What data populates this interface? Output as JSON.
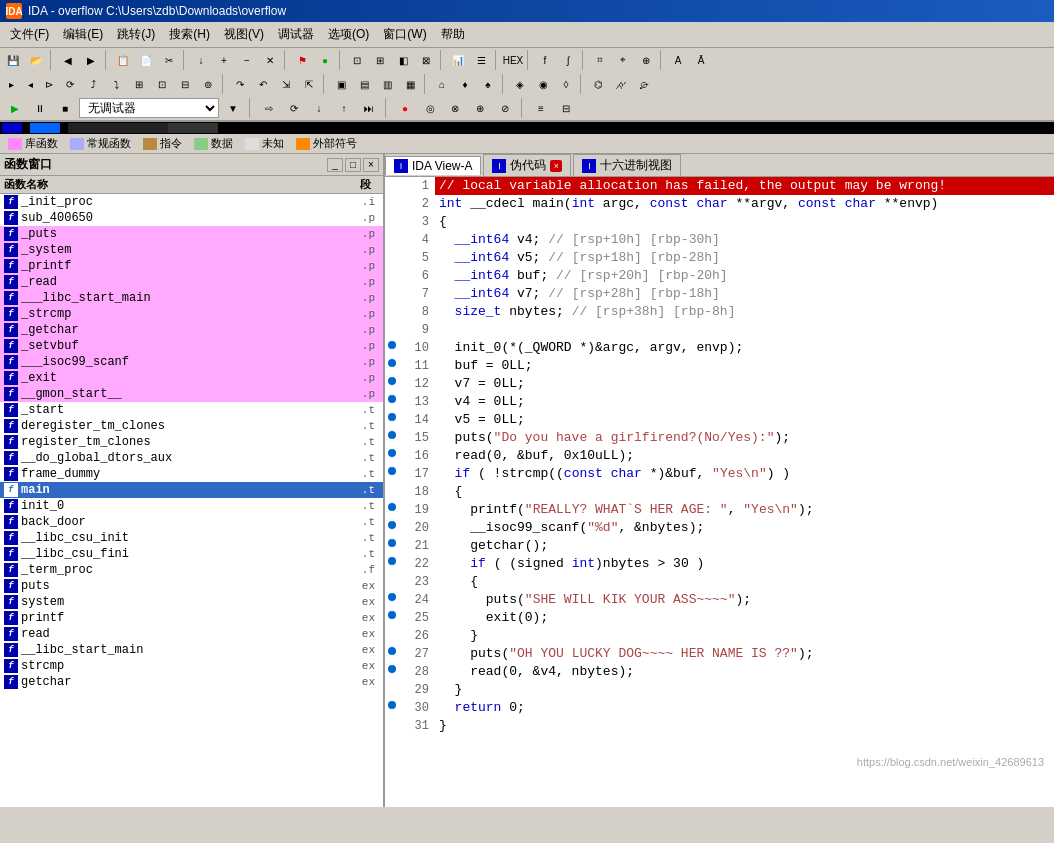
{
  "titlebar": {
    "label": "IDA - overflow C:\\Users\\zdb\\Downloads\\overflow"
  },
  "menubar": {
    "items": [
      {
        "label": "文件(F)"
      },
      {
        "label": "编辑(E)"
      },
      {
        "label": "跳转(J)"
      },
      {
        "label": "搜索(H)"
      },
      {
        "label": "视图(V)"
      },
      {
        "label": "调试器"
      },
      {
        "label": "选项(O)"
      },
      {
        "label": "窗口(W)"
      },
      {
        "label": "帮助"
      }
    ]
  },
  "legend": {
    "items": [
      {
        "label": "库函数",
        "color": "#ff88ff"
      },
      {
        "label": "常规函数",
        "color": "#aaaaff"
      },
      {
        "label": "指令",
        "color": "#bb8844"
      },
      {
        "label": "数据",
        "color": "#88cc88"
      },
      {
        "label": "未知",
        "color": "#dddddd"
      },
      {
        "label": "外部符号",
        "color": "#ff8800"
      }
    ]
  },
  "funcpanel": {
    "title": "函数窗口",
    "col_name": "函数名称",
    "col_seg": "段",
    "functions": [
      {
        "name": "_init_proc",
        "seg": ".i",
        "highlight": false
      },
      {
        "name": "sub_400650",
        "seg": ".p",
        "highlight": false
      },
      {
        "name": "_puts",
        "seg": ".p",
        "highlight": true
      },
      {
        "name": "_system",
        "seg": ".p",
        "highlight": true
      },
      {
        "name": "_printf",
        "seg": ".p",
        "highlight": true
      },
      {
        "name": "_read",
        "seg": ".p",
        "highlight": true
      },
      {
        "name": "___libc_start_main",
        "seg": ".p",
        "highlight": true
      },
      {
        "name": "_strcmp",
        "seg": ".p",
        "highlight": true
      },
      {
        "name": "_getchar",
        "seg": ".p",
        "highlight": true
      },
      {
        "name": "_setvbuf",
        "seg": ".p",
        "highlight": true
      },
      {
        "name": "___isoc99_scanf",
        "seg": ".p",
        "highlight": true
      },
      {
        "name": "_exit",
        "seg": ".p",
        "highlight": true
      },
      {
        "name": "__gmon_start__",
        "seg": ".p",
        "highlight": true
      },
      {
        "name": "_start",
        "seg": ".t",
        "highlight": false
      },
      {
        "name": "deregister_tm_clones",
        "seg": ".t",
        "highlight": false
      },
      {
        "name": "register_tm_clones",
        "seg": ".t",
        "highlight": false
      },
      {
        "name": "__do_global_dtors_aux",
        "seg": ".t",
        "highlight": false
      },
      {
        "name": "frame_dummy",
        "seg": ".t",
        "highlight": false
      },
      {
        "name": "main",
        "seg": ".t",
        "highlight": false,
        "selected": true,
        "bold": true
      },
      {
        "name": "init_0",
        "seg": ".t",
        "highlight": false
      },
      {
        "name": "back_door",
        "seg": ".t",
        "highlight": false
      },
      {
        "name": "__libc_csu_init",
        "seg": ".t",
        "highlight": false
      },
      {
        "name": "__libc_csu_fini",
        "seg": ".t",
        "highlight": false
      },
      {
        "name": "_term_proc",
        "seg": ".f",
        "highlight": false
      },
      {
        "name": "puts",
        "seg": "ex",
        "highlight": false
      },
      {
        "name": "system",
        "seg": "ex",
        "highlight": false
      },
      {
        "name": "printf",
        "seg": "ex",
        "highlight": false
      },
      {
        "name": "read",
        "seg": "ex",
        "highlight": false
      },
      {
        "name": "__libc_start_main",
        "seg": "ex",
        "highlight": false
      },
      {
        "name": "strcmp",
        "seg": "ex",
        "highlight": false
      },
      {
        "name": "getchar",
        "seg": "ex",
        "highlight": false
      }
    ]
  },
  "codetabs": {
    "tabs": [
      {
        "label": "IDA View-A",
        "active": true,
        "closeable": false
      },
      {
        "label": "伪代码",
        "active": false,
        "closeable": true
      },
      {
        "label": "十六进制视图",
        "active": false,
        "closeable": false
      }
    ]
  },
  "codelines": [
    {
      "num": 1,
      "has_dot": false,
      "error_line": true,
      "code": "// local variable allocation has failed, the output may be wrong!"
    },
    {
      "num": 2,
      "has_dot": false,
      "error_line": false,
      "code": "int __cdecl main(int argc, const char **argv, const char **envp)"
    },
    {
      "num": 3,
      "has_dot": false,
      "error_line": false,
      "code": "{"
    },
    {
      "num": 4,
      "has_dot": false,
      "error_line": false,
      "code": "  __int64 v4; // [rsp+10h] [rbp-30h]"
    },
    {
      "num": 5,
      "has_dot": false,
      "error_line": false,
      "code": "  __int64 v5; // [rsp+18h] [rbp-28h]"
    },
    {
      "num": 6,
      "has_dot": false,
      "error_line": false,
      "code": "  __int64 buf; // [rsp+20h] [rbp-20h]"
    },
    {
      "num": 7,
      "has_dot": false,
      "error_line": false,
      "code": "  __int64 v7; // [rsp+28h] [rbp-18h]"
    },
    {
      "num": 8,
      "has_dot": false,
      "error_line": false,
      "code": "  size_t nbytes; // [rsp+38h] [rbp-8h]"
    },
    {
      "num": 9,
      "has_dot": false,
      "error_line": false,
      "code": ""
    },
    {
      "num": 10,
      "has_dot": true,
      "error_line": false,
      "code": "  init_0(*(_QWORD *)&argc, argv, envp);"
    },
    {
      "num": 11,
      "has_dot": true,
      "error_line": false,
      "code": "  buf = 0LL;"
    },
    {
      "num": 12,
      "has_dot": true,
      "error_line": false,
      "code": "  v7 = 0LL;"
    },
    {
      "num": 13,
      "has_dot": true,
      "error_line": false,
      "code": "  v4 = 0LL;"
    },
    {
      "num": 14,
      "has_dot": true,
      "error_line": false,
      "code": "  v5 = 0LL;"
    },
    {
      "num": 15,
      "has_dot": true,
      "error_line": false,
      "code": "  puts(\"Do you have a girlfirend?(No/Yes):\");"
    },
    {
      "num": 16,
      "has_dot": true,
      "error_line": false,
      "code": "  read(0, &buf, 0x10uLL);"
    },
    {
      "num": 17,
      "has_dot": true,
      "error_line": false,
      "code": "  if ( !strcmp((const char *)&buf, \"Yes\\n\") )"
    },
    {
      "num": 18,
      "has_dot": false,
      "error_line": false,
      "code": "  {"
    },
    {
      "num": 19,
      "has_dot": true,
      "error_line": false,
      "code": "    printf(\"REALLY? WHAT`S HER AGE: \", \"Yes\\n\");"
    },
    {
      "num": 20,
      "has_dot": true,
      "error_line": false,
      "code": "    __isoc99_scanf(\"%d\", &nbytes);"
    },
    {
      "num": 21,
      "has_dot": true,
      "error_line": false,
      "code": "    getchar();"
    },
    {
      "num": 22,
      "has_dot": true,
      "error_line": false,
      "code": "    if ( (signed int)nbytes > 30 )"
    },
    {
      "num": 23,
      "has_dot": false,
      "error_line": false,
      "code": "    {"
    },
    {
      "num": 24,
      "has_dot": true,
      "error_line": false,
      "code": "      puts(\"SHE WILL KIK YOUR ASS~~~~\");"
    },
    {
      "num": 25,
      "has_dot": true,
      "error_line": false,
      "code": "      exit(0);"
    },
    {
      "num": 26,
      "has_dot": false,
      "error_line": false,
      "code": "    }"
    },
    {
      "num": 27,
      "has_dot": true,
      "error_line": false,
      "code": "    puts(\"OH YOU LUCKY DOG~~~~ HER NAME IS ??\");"
    },
    {
      "num": 28,
      "has_dot": true,
      "error_line": false,
      "code": "    read(0, &v4, nbytes);"
    },
    {
      "num": 29,
      "has_dot": false,
      "error_line": false,
      "code": "  }"
    },
    {
      "num": 30,
      "has_dot": true,
      "error_line": false,
      "code": "  return 0;"
    },
    {
      "num": 31,
      "has_dot": false,
      "error_line": false,
      "code": "}"
    }
  ],
  "watermark": "https://blog.csdn.net/weixin_42689613",
  "debugger_select": {
    "label": "无调试器",
    "options": [
      "无调试器"
    ]
  }
}
